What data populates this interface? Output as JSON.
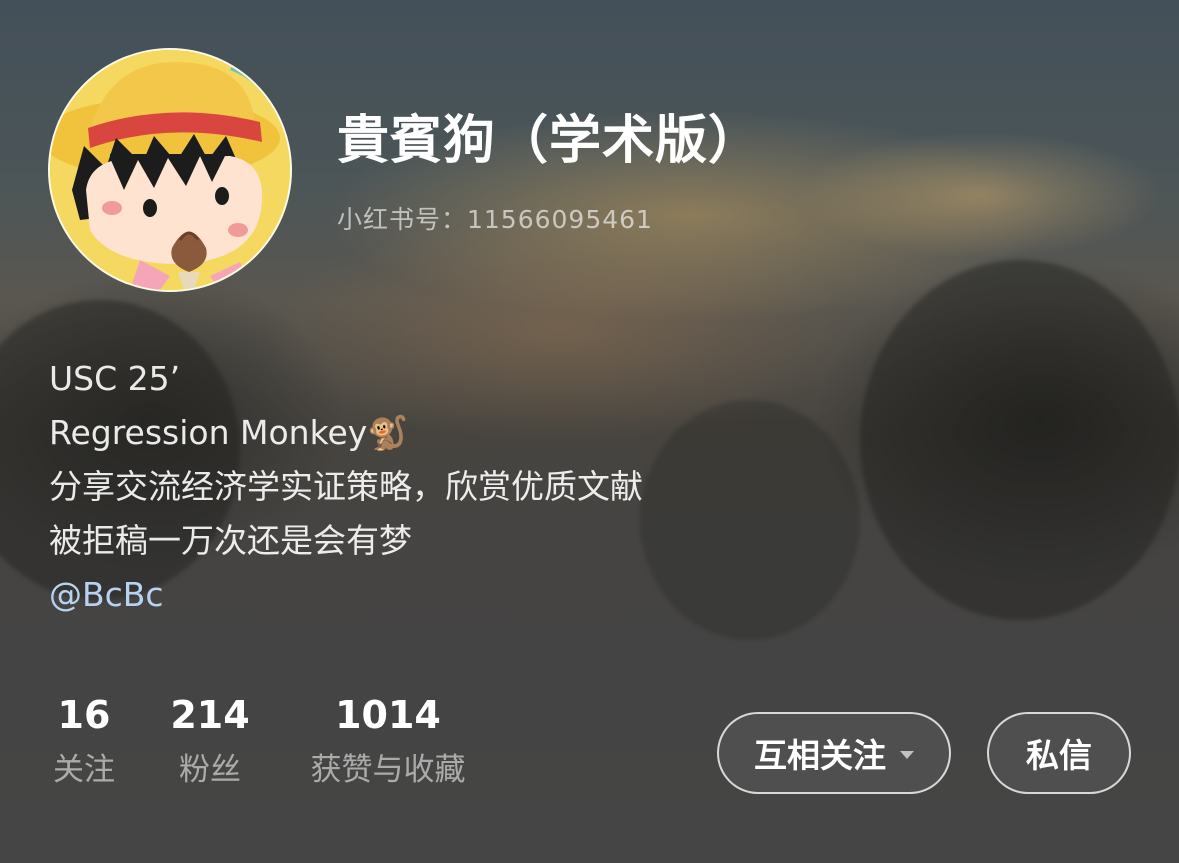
{
  "profile": {
    "nickname": "貴賓狗（学术版）",
    "red_id": "小红书号：11566095461",
    "avatar_icon": "cartoon-girl-ice-cream-avatar"
  },
  "bio": {
    "line1": "USC 25’",
    "line2": "Regression Monkey🐒",
    "line3": "分享交流经济学实证策略，欣赏优质文献",
    "line4": "被拒稿一万次还是会有梦",
    "mention": "@BcBc"
  },
  "stats": {
    "following": {
      "value": "16",
      "label": "关注"
    },
    "followers": {
      "value": "214",
      "label": "粉丝"
    },
    "likes": {
      "value": "1014",
      "label": "获赞与收藏"
    }
  },
  "actions": {
    "follow_label": "互相关注",
    "message_label": "私信"
  },
  "colors": {
    "mention": "#b8d3f2",
    "text_primary": "#ffffff"
  }
}
